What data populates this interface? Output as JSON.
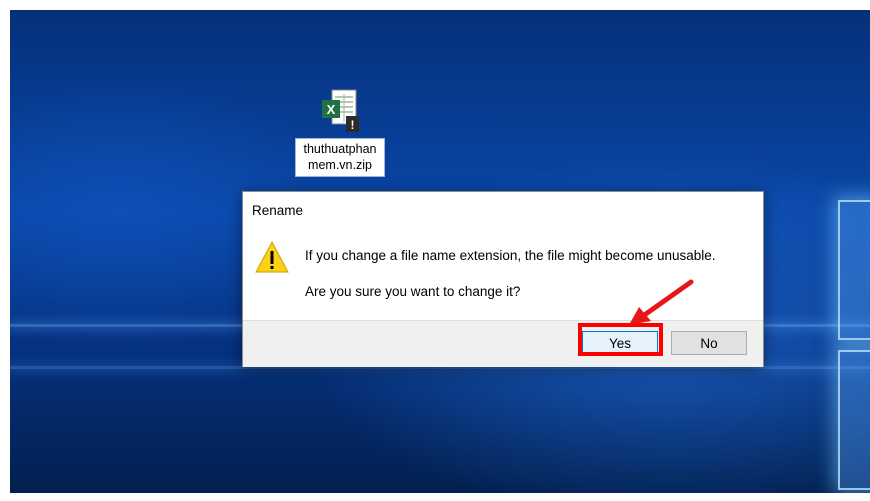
{
  "desktop": {
    "file": {
      "icon": "excel-file-warning-icon",
      "label": "thuthuatphanmem.vn.zip"
    }
  },
  "dialog": {
    "title": "Rename",
    "icon": "warning-icon",
    "message_line1": "If you change a file name extension, the file might become unusable.",
    "message_line2": "Are you sure you want to change it?",
    "buttons": {
      "yes": "Yes",
      "no": "No"
    }
  },
  "annotation": {
    "highlight_color": "#ff0000",
    "arrow_color": "#e8161b"
  }
}
